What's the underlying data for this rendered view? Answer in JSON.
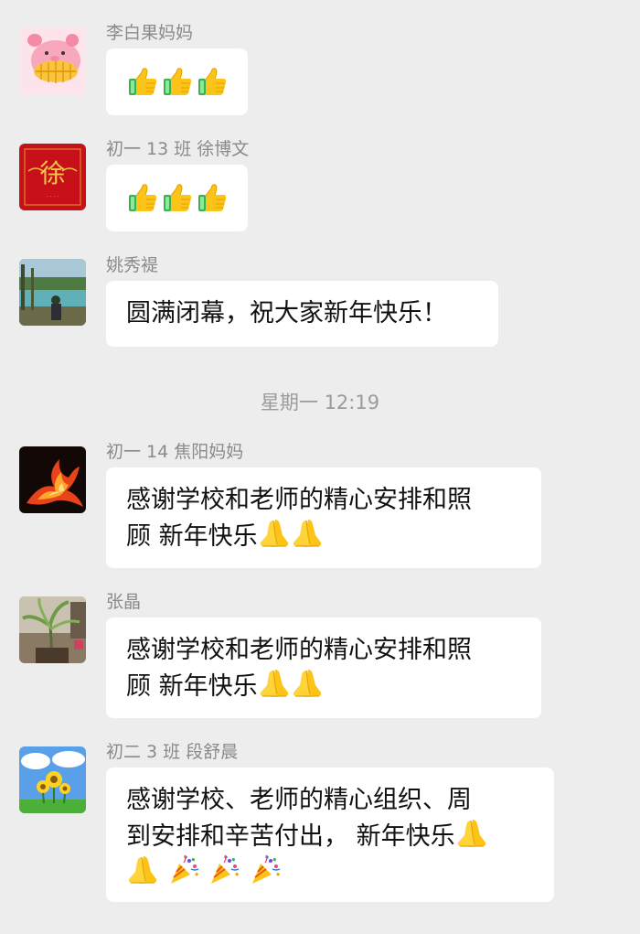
{
  "messages": [
    {
      "sender": "李白果妈妈",
      "avatar": "pig-avatar-icon",
      "emojis": [
        "thumbs-up-icon",
        "thumbs-up-icon",
        "thumbs-up-icon"
      ]
    },
    {
      "sender": "初一 13 班 徐博文",
      "avatar": "red-calligraphy-avatar-icon",
      "avatar_text": "徐",
      "emojis": [
        "thumbs-up-icon",
        "thumbs-up-icon",
        "thumbs-up-icon"
      ]
    },
    {
      "sender": "姚秀褆",
      "avatar": "lake-landscape-avatar-icon",
      "text": "圆满闭幕，祝大家新年快乐！"
    },
    {
      "sender": "初一 14 焦阳妈妈",
      "avatar": "phoenix-fire-avatar-icon",
      "line1": "感谢学校和老师的精心安排和照",
      "line2": "顾 新年快乐",
      "line2_emojis": [
        "praying-hands-icon",
        "praying-hands-icon"
      ]
    },
    {
      "sender": "张晶",
      "avatar": "plant-room-avatar-icon",
      "line1": "感谢学校和老师的精心安排和照",
      "line2": "顾 新年快乐",
      "line2_emojis": [
        "praying-hands-icon",
        "praying-hands-icon"
      ]
    },
    {
      "sender": "初二 3 班 段舒晨",
      "avatar": "sunflower-avatar-icon",
      "line1": "感谢学校、老师的精心组织、周",
      "line2": "到安排和辛苦付出， 新年快乐",
      "line2_emojis": [
        "praying-hands-icon"
      ],
      "line3_emojis": [
        "praying-hands-icon",
        "party-popper-icon",
        "party-popper-icon",
        "party-popper-icon"
      ]
    }
  ],
  "timestamp": "星期一 12:19",
  "colors": {
    "background": "#ededed",
    "bubble": "#ffffff",
    "sender_text": "#8a8a8a",
    "timestamp_text": "#9b9b9b"
  }
}
